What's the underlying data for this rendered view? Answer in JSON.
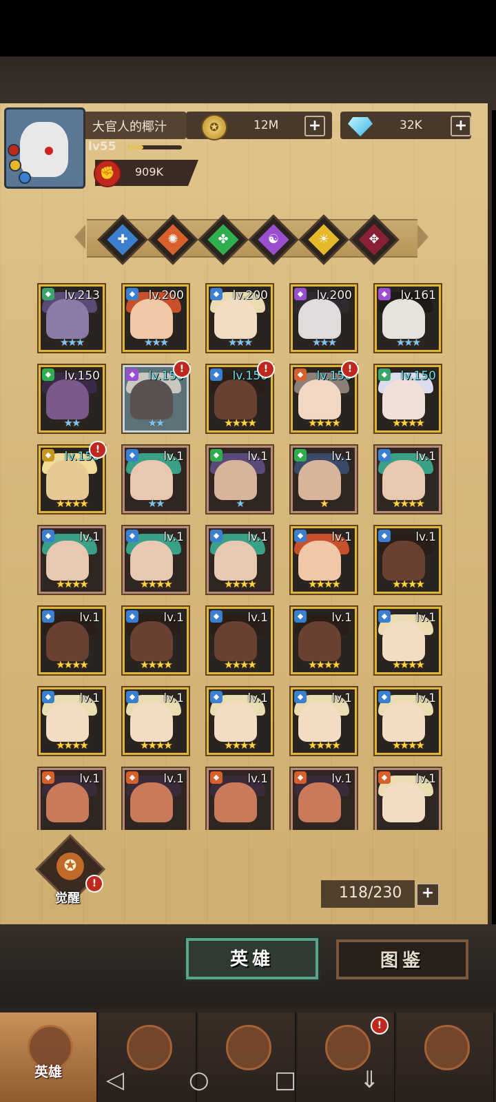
{
  "player": {
    "name": "大官人的椰汁",
    "level": "lv55",
    "power": "909K"
  },
  "resources": {
    "gold": "12M",
    "diamonds": "32K",
    "plus": "+"
  },
  "factions": [
    {
      "name": "faction-light-icon",
      "color": "#3a7fd0",
      "symbol": "✚"
    },
    {
      "name": "faction-fire-icon",
      "color": "#d8602a",
      "symbol": "✺"
    },
    {
      "name": "faction-nature-icon",
      "color": "#2fae4e",
      "symbol": "✤"
    },
    {
      "name": "faction-arcane-icon",
      "color": "#9a4fd0",
      "symbol": "☯"
    },
    {
      "name": "faction-holy-icon",
      "color": "#e6b92a",
      "symbol": "☀"
    },
    {
      "name": "faction-dark-icon",
      "color": "#8a2038",
      "symbol": "✥"
    }
  ],
  "heroes": [
    {
      "level": "lv.213",
      "stars": "★★★",
      "star_color": "blue",
      "frame": "gold",
      "faction": "#3aa46a",
      "skin": "#8c7aa8",
      "hair": "#5a4a78",
      "level_color": "white",
      "alert": false
    },
    {
      "level": "lv.200",
      "stars": "★★★",
      "star_color": "blue",
      "frame": "gold",
      "faction": "#3a7fd0",
      "skin": "#f0c8a8",
      "hair": "#c8502a",
      "level_color": "white",
      "alert": false
    },
    {
      "level": "lv.200",
      "stars": "★★★",
      "star_color": "blue",
      "frame": "gold",
      "faction": "#3a7fd0",
      "skin": "#f2dcc4",
      "hair": "#e8dcb0",
      "level_color": "white",
      "alert": false
    },
    {
      "level": "lv.200",
      "stars": "★★★",
      "star_color": "blue",
      "frame": "gold",
      "faction": "#9a4fd0",
      "skin": "#e0dcdc",
      "hair": "#2e2a30",
      "level_color": "white",
      "alert": false
    },
    {
      "level": "lv.161",
      "stars": "★★★",
      "star_color": "blue",
      "frame": "gold",
      "faction": "#9a4fd0",
      "skin": "#e8e2dc",
      "hair": "#1e1a1a",
      "level_color": "white",
      "alert": false
    },
    {
      "level": "lv.150",
      "stars": "★★",
      "star_color": "blue",
      "frame": "gold",
      "faction": "#2fae4e",
      "skin": "#7a5a8a",
      "hair": "#3a2a48",
      "level_color": "white",
      "alert": false
    },
    {
      "level": "lv.150",
      "stars": "★★",
      "star_color": "blue",
      "frame": "silver",
      "faction": "#9a4fd0",
      "skin": "#5a5050",
      "hair": "#c8c8c0",
      "level_color": "cyan",
      "alert": true
    },
    {
      "level": "lv.150",
      "stars": "★★★★",
      "star_color": "gold",
      "frame": "gold",
      "faction": "#3a7fd0",
      "skin": "#6a4032",
      "hair": "#2a1e18",
      "level_color": "cyan",
      "alert": true
    },
    {
      "level": "lv.150",
      "stars": "★★★★",
      "star_color": "gold",
      "frame": "gold",
      "faction": "#d8602a",
      "skin": "#f0d8c4",
      "hair": "#8a8078",
      "level_color": "cyan",
      "alert": true
    },
    {
      "level": "lv.150",
      "stars": "★★★★",
      "star_color": "gold",
      "frame": "gold",
      "faction": "#3aa46a",
      "skin": "#f0e0d8",
      "hair": "#d8dcec",
      "level_color": "cyan",
      "alert": false
    },
    {
      "level": "lv.150",
      "stars": "★★★★",
      "star_color": "gold",
      "frame": "gold",
      "faction": "#c8961e",
      "skin": "#e8c894",
      "hair": "#f0dc98",
      "level_color": "cyan",
      "alert": true
    },
    {
      "level": "lv.1",
      "stars": "★★",
      "star_color": "blue",
      "frame": "bronze",
      "faction": "#3a7fd0",
      "skin": "#e8c8b0",
      "hair": "#3aa088",
      "level_color": "white",
      "alert": false
    },
    {
      "level": "lv.1",
      "stars": "★",
      "star_color": "blue",
      "frame": "bronze",
      "faction": "#2fae4e",
      "skin": "#d8b49a",
      "hair": "#5a4a7a",
      "level_color": "white",
      "alert": false
    },
    {
      "level": "lv.1",
      "stars": "★",
      "star_color": "gold",
      "frame": "bronze",
      "faction": "#2fae4e",
      "skin": "#d8b49a",
      "hair": "#3a4a6a",
      "level_color": "white",
      "alert": false
    },
    {
      "level": "lv.1",
      "stars": "★★★★",
      "star_color": "gold",
      "frame": "bronze",
      "faction": "#3a7fd0",
      "skin": "#e8c8b0",
      "hair": "#3aa088",
      "level_color": "white",
      "alert": false
    },
    {
      "level": "lv.1",
      "stars": "★★★★",
      "star_color": "gold",
      "frame": "bronze",
      "faction": "#3a7fd0",
      "skin": "#e8c8b0",
      "hair": "#3aa088",
      "level_color": "white",
      "alert": false
    },
    {
      "level": "lv.1",
      "stars": "★★★★",
      "star_color": "gold",
      "frame": "bronze",
      "faction": "#3a7fd0",
      "skin": "#e8c8b0",
      "hair": "#3aa088",
      "level_color": "white",
      "alert": false
    },
    {
      "level": "lv.1",
      "stars": "★★★★",
      "star_color": "gold",
      "frame": "bronze",
      "faction": "#3a7fd0",
      "skin": "#e8c8b0",
      "hair": "#3aa088",
      "level_color": "white",
      "alert": false
    },
    {
      "level": "lv.1",
      "stars": "★★★★",
      "star_color": "gold",
      "frame": "gold",
      "faction": "#3a7fd0",
      "skin": "#f0c8a8",
      "hair": "#c8502a",
      "level_color": "white",
      "alert": false
    },
    {
      "level": "lv.1",
      "stars": "★★★★",
      "star_color": "gold",
      "frame": "gold",
      "faction": "#3a7fd0",
      "skin": "#6a4032",
      "hair": "#2a1e18",
      "level_color": "white",
      "alert": false
    },
    {
      "level": "lv.1",
      "stars": "★★★★",
      "star_color": "gold",
      "frame": "gold",
      "faction": "#3a7fd0",
      "skin": "#6a4032",
      "hair": "#2a1e18",
      "level_color": "white",
      "alert": false
    },
    {
      "level": "lv.1",
      "stars": "★★★★",
      "star_color": "gold",
      "frame": "gold",
      "faction": "#3a7fd0",
      "skin": "#6a4032",
      "hair": "#2a1e18",
      "level_color": "white",
      "alert": false
    },
    {
      "level": "lv.1",
      "stars": "★★★★",
      "star_color": "gold",
      "frame": "gold",
      "faction": "#3a7fd0",
      "skin": "#6a4032",
      "hair": "#2a1e18",
      "level_color": "white",
      "alert": false
    },
    {
      "level": "lv.1",
      "stars": "★★★★",
      "star_color": "gold",
      "frame": "gold",
      "faction": "#3a7fd0",
      "skin": "#6a4032",
      "hair": "#2a1e18",
      "level_color": "white",
      "alert": false
    },
    {
      "level": "lv.1",
      "stars": "★★★★",
      "star_color": "gold",
      "frame": "gold",
      "faction": "#3a7fd0",
      "skin": "#f2dcc4",
      "hair": "#e8dcb0",
      "level_color": "white",
      "alert": false
    },
    {
      "level": "lv.1",
      "stars": "★★★★",
      "star_color": "gold",
      "frame": "gold",
      "faction": "#3a7fd0",
      "skin": "#f2dcc4",
      "hair": "#e8dcb0",
      "level_color": "white",
      "alert": false
    },
    {
      "level": "lv.1",
      "stars": "★★★★",
      "star_color": "gold",
      "frame": "gold",
      "faction": "#3a7fd0",
      "skin": "#f2dcc4",
      "hair": "#e8dcb0",
      "level_color": "white",
      "alert": false
    },
    {
      "level": "lv.1",
      "stars": "★★★★",
      "star_color": "gold",
      "frame": "gold",
      "faction": "#3a7fd0",
      "skin": "#f2dcc4",
      "hair": "#e8dcb0",
      "level_color": "white",
      "alert": false
    },
    {
      "level": "lv.1",
      "stars": "★★★★",
      "star_color": "gold",
      "frame": "gold",
      "faction": "#3a7fd0",
      "skin": "#f2dcc4",
      "hair": "#e8dcb0",
      "level_color": "white",
      "alert": false
    },
    {
      "level": "lv.1",
      "stars": "★★★★",
      "star_color": "gold",
      "frame": "gold",
      "faction": "#3a7fd0",
      "skin": "#f2dcc4",
      "hair": "#e8dcb0",
      "level_color": "white",
      "alert": false
    },
    {
      "level": "lv.1",
      "stars": "",
      "star_color": "gold",
      "frame": "bronze",
      "faction": "#d8602a",
      "skin": "#c87a5a",
      "hair": "#3a2a3a",
      "level_color": "white",
      "alert": false
    },
    {
      "level": "lv.1",
      "stars": "",
      "star_color": "gold",
      "frame": "bronze",
      "faction": "#d8602a",
      "skin": "#c87a5a",
      "hair": "#3a2a3a",
      "level_color": "white",
      "alert": false
    },
    {
      "level": "lv.1",
      "stars": "",
      "star_color": "gold",
      "frame": "bronze",
      "faction": "#d8602a",
      "skin": "#c87a5a",
      "hair": "#3a2a3a",
      "level_color": "white",
      "alert": false
    },
    {
      "level": "lv.1",
      "stars": "",
      "star_color": "gold",
      "frame": "bronze",
      "faction": "#d8602a",
      "skin": "#c87a5a",
      "hair": "#3a2a3a",
      "level_color": "white",
      "alert": false
    },
    {
      "level": "lv.1",
      "stars": "",
      "star_color": "gold",
      "frame": "bronze",
      "faction": "#d8602a",
      "skin": "#f2dcc4",
      "hair": "#e8dcb0",
      "level_color": "white",
      "alert": false
    }
  ],
  "awaken": {
    "label": "觉醒"
  },
  "capacity": {
    "value": "118/230"
  },
  "tabs": {
    "hero": "英雄",
    "codex": "图鉴"
  },
  "bottom_nav": [
    {
      "name": "nav-heroes",
      "label": "英雄",
      "active": true,
      "alert": false
    },
    {
      "name": "nav-adventure",
      "label": "",
      "active": false,
      "alert": false
    },
    {
      "name": "nav-battle",
      "label": "",
      "active": false,
      "alert": false
    },
    {
      "name": "nav-castle",
      "label": "",
      "active": false,
      "alert": true
    },
    {
      "name": "nav-guild",
      "label": "",
      "active": false,
      "alert": false
    }
  ],
  "system_nav": {
    "back": "◁",
    "home": "○",
    "recents": "□",
    "down": "⇓"
  },
  "alert_glyph": "!"
}
